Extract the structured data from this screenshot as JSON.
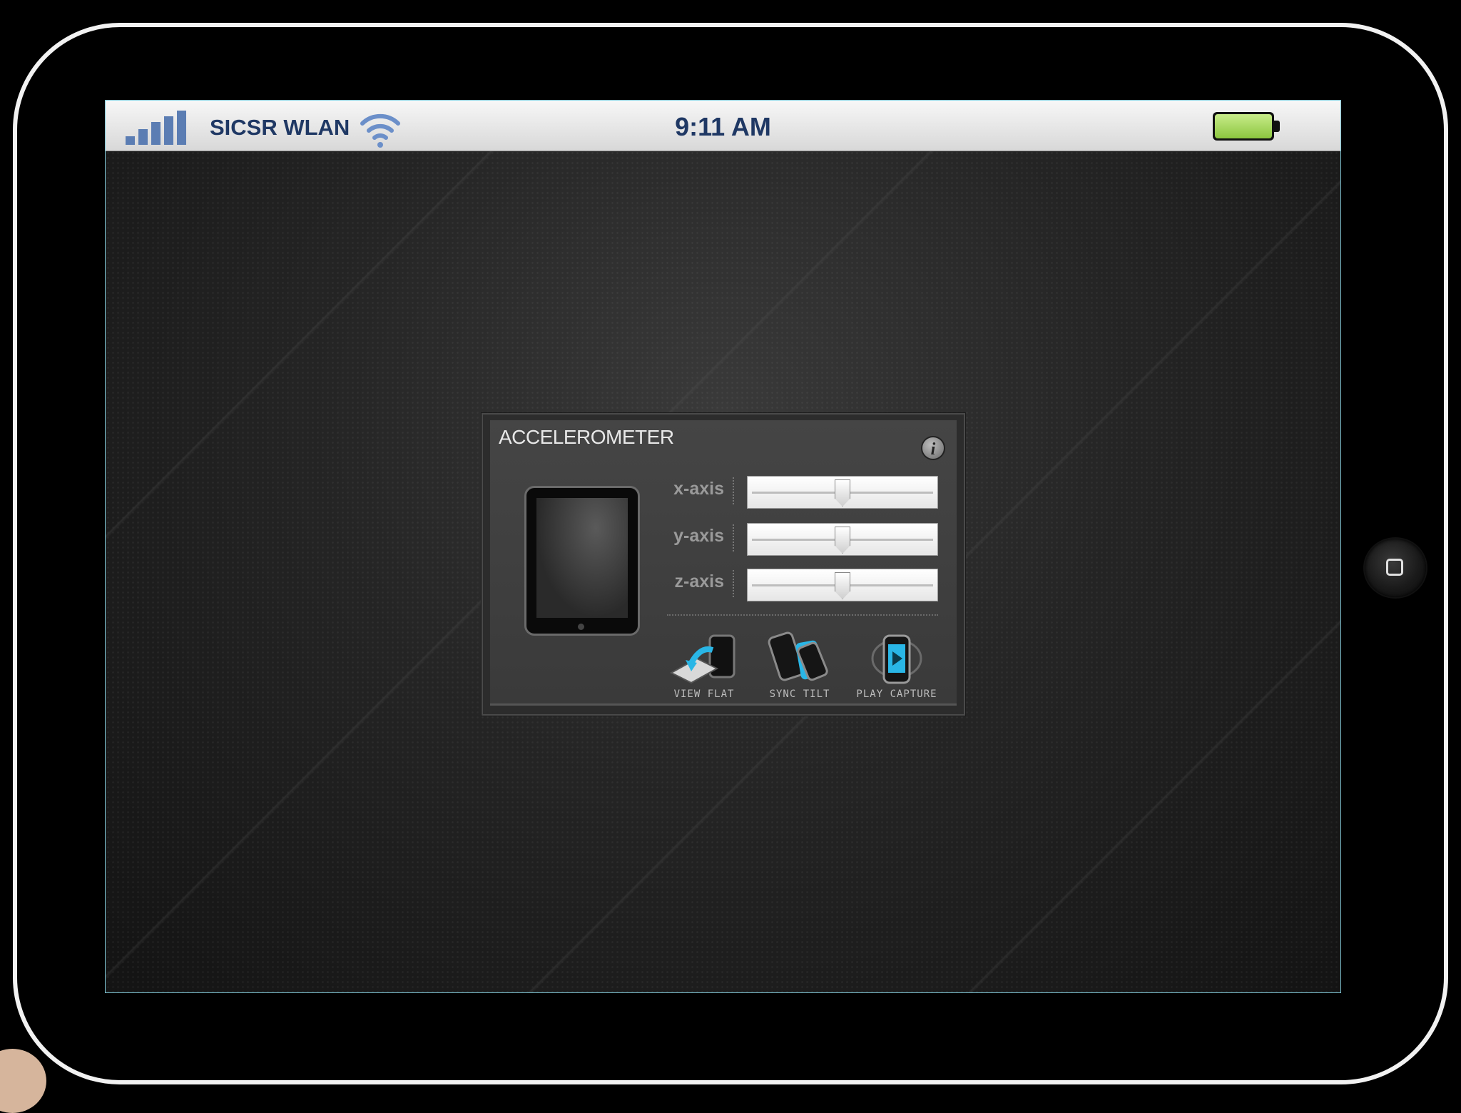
{
  "status_bar": {
    "carrier": "SICSR WLAN",
    "time": "9:11 AM",
    "signal_icon": "signal-bars-icon",
    "wifi_icon": "wifi-icon",
    "battery_icon": "battery-icon",
    "battery_level": 1.0
  },
  "panel": {
    "title": "ACCELEROMETER",
    "info_icon": "i",
    "axes": [
      {
        "label": "x-axis",
        "value": 0.5
      },
      {
        "label": "y-axis",
        "value": 0.5
      },
      {
        "label": "z-axis",
        "value": 0.5
      }
    ],
    "tools": [
      {
        "label": "VIEW FLAT",
        "icon": "view-flat-icon"
      },
      {
        "label": "SYNC TILT",
        "icon": "sync-tilt-icon"
      },
      {
        "label": "PLAY CAPTURE",
        "icon": "play-capture-icon"
      }
    ]
  },
  "colors": {
    "status_text": "#1f3864",
    "signal": "#5b7db3",
    "wifi": "#6b8fc9",
    "battery": "#8cc63f",
    "accent": "#29b6e6"
  }
}
